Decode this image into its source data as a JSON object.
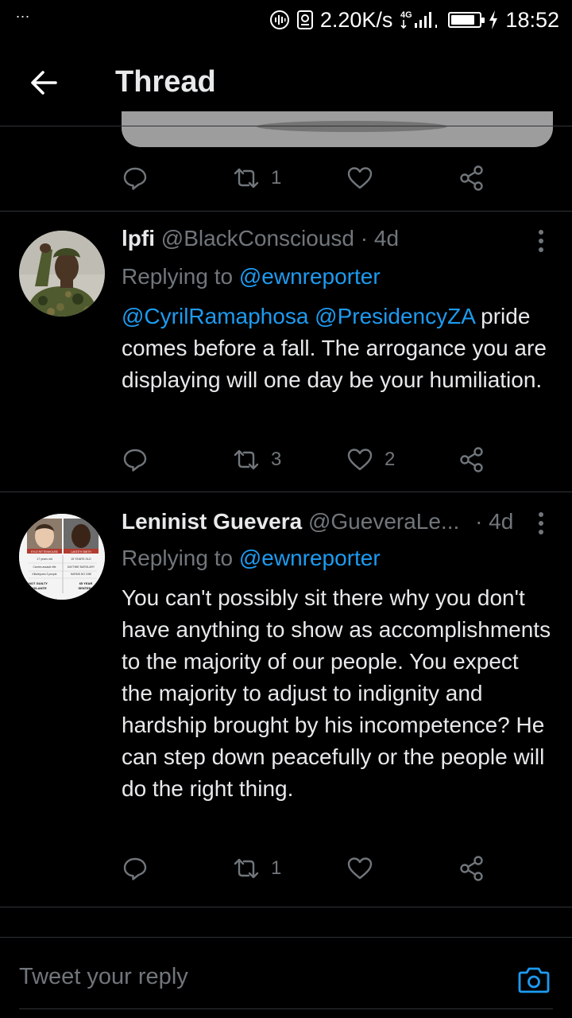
{
  "status_bar": {
    "dots": "...",
    "speed": "2.20K/s",
    "network": "4G",
    "battery_level": 0.85,
    "time": "18:52"
  },
  "header": {
    "title": "Thread",
    "back_icon": "arrow-left-icon"
  },
  "top_tweet": {
    "retweet_count": "1"
  },
  "tweets": [
    {
      "name": "lpfi",
      "handle": "@BlackConsciousd",
      "time": "· 4d",
      "replying_prefix": "Replying to",
      "replying_to": "@ewnreporter",
      "mention1": "@CyrilRamaphosa",
      "mention2": "@PresidencyZA",
      "text": " pride comes before a fall. The arrogance you are displaying will one day be your humiliation.",
      "retweets": "3",
      "likes": "2"
    },
    {
      "name": "Leninist Guevera",
      "handle": "@GueveraLe...",
      "time": "· 4d",
      "replying_prefix": "Replying to",
      "replying_to": "@ewnreporter",
      "text": "You can't possibly sit there why you don't have anything to show as accomplishments to the majority of our people. You expect the majority to adjust to indignity and hardship brought by his incompetence? He can step down peacefully or the people will do the right thing.",
      "retweets": "1",
      "likes": "",
      "avatar_text": {
        "left_name": "KYLE RITTENHOUSE",
        "right_name": "LAKEITH SMITH",
        "left_age": "17 years old",
        "right_age": "15 YEARS OLD",
        "left_line1": "Carries assault rifle",
        "right_line1": "DAYTIME BURGLARY",
        "left_line2": "Kills/injures 3 people",
        "right_line2": "HARMS NO ONE",
        "left_verdict_1": "NOT GUILTY",
        "left_verdict_2": "VIGILANTE",
        "right_verdict_1": "65 YEAR",
        "right_verdict_2": "SENTENC"
      }
    }
  ],
  "reply_bar": {
    "placeholder": "Tweet your reply",
    "camera_icon": "camera-icon"
  },
  "colors": {
    "background": "#000000",
    "text": "#e7e9ea",
    "muted": "#71767b",
    "link": "#1d9bf0",
    "divider": "#2f3336"
  }
}
